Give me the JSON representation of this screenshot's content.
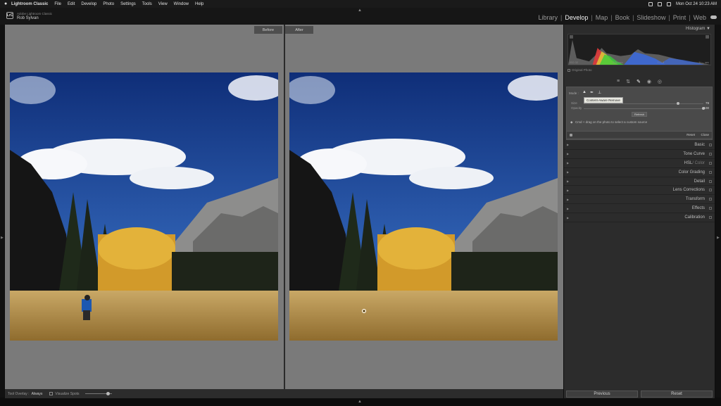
{
  "menubar": {
    "app": "Lightroom Classic",
    "items": [
      "File",
      "Edit",
      "Develop",
      "Photo",
      "Settings",
      "Tools",
      "View",
      "Window",
      "Help"
    ],
    "clock": "Mon Oct 24  10:23 AM"
  },
  "identity": {
    "product": "Adobe Lightroom Classic",
    "user": "Rob Sylvan",
    "logo": "LrC"
  },
  "modules": [
    {
      "label": "Library",
      "active": false
    },
    {
      "label": "Develop",
      "active": true
    },
    {
      "label": "Map",
      "active": false
    },
    {
      "label": "Book",
      "active": false
    },
    {
      "label": "Slideshow",
      "active": false
    },
    {
      "label": "Print",
      "active": false
    },
    {
      "label": "Web",
      "active": false
    }
  ],
  "view": {
    "before_label": "Before",
    "after_label": "After"
  },
  "toolbar": {
    "overlay_label": "Tool Overlay :",
    "overlay_value": "Always",
    "visualize_label": "Visualize Spots"
  },
  "histogram": {
    "title": "Histogram",
    "iso": "ISO 32",
    "focal": "4.28 mm",
    "aperture": "f / 1.8",
    "shutter": "1/₆₉₀ sec",
    "original_photo": "Original Photo"
  },
  "heal": {
    "mode_label": "Mode :",
    "tooltip": "Content-Aware Remove",
    "size_label": "Size",
    "size_value": "79",
    "opacity_label": "Opacity",
    "opacity_value": "100",
    "size_fraction": 0.79,
    "opacity_fraction": 1.0,
    "refresh_label": "Refresh",
    "hint": "Cmd + drag on the photo to select a custom source",
    "reset_label": "Reset",
    "close_label": "Close"
  },
  "sections": [
    {
      "label": "Basic"
    },
    {
      "label": "Tone Curve"
    },
    {
      "label": "HSL",
      "suffix": " / Color"
    },
    {
      "label": "Color Grading"
    },
    {
      "label": "Detail"
    },
    {
      "label": "Lens Corrections"
    },
    {
      "label": "Transform"
    },
    {
      "label": "Effects"
    },
    {
      "label": "Calibration"
    }
  ],
  "nav": {
    "previous_label": "Previous",
    "reset_label": "Reset"
  },
  "colors": {
    "panel": "#2c2c2c",
    "view_bg": "#7a7a7a",
    "sky": "#1f4fa0",
    "grass": "#b89650"
  }
}
